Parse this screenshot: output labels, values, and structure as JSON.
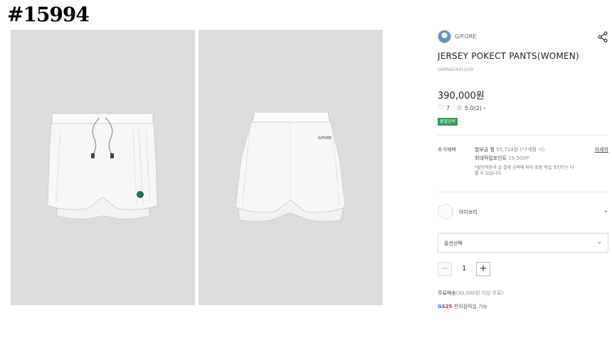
{
  "watermark": "#15994",
  "brand": {
    "name": "G/FORE"
  },
  "product": {
    "title": "JERSEY POKECT PANTS(WOMEN)",
    "code": "GNPNA24451/VX",
    "price": "390,000원",
    "likes": "7",
    "rating": "5.0(2)",
    "rating_arrow": "›",
    "badge": "품절임박"
  },
  "benefits": {
    "label": "추가혜택",
    "installment_prefix": "할부금 월",
    "installment_value": "55,714원 (*7개월 시)",
    "points_prefix": "최대적립포인트",
    "points_value": "19,500P",
    "detail_link": "자세히",
    "note": "*할인적용과 실 결제 금액에 따라 최종 적립 포인트는 다를 수 있습니다."
  },
  "color_option": {
    "label": "아이보리",
    "chevron": "⌄"
  },
  "option_select": {
    "label": "옵션선택",
    "chevron": "⌄"
  },
  "quantity": {
    "minus": "−",
    "value": "1",
    "plus": "+"
  },
  "shipping": {
    "prefix": "무료배송",
    "detail": "(30,000원 이상 무료)"
  },
  "pickup": {
    "logo_gs": "GS",
    "logo_num": "25",
    "text": "편의점픽업 가능"
  },
  "product_image_logo": "G/FORE",
  "icons": {
    "heart": "♡",
    "star": "☆",
    "share": "share-icon"
  }
}
